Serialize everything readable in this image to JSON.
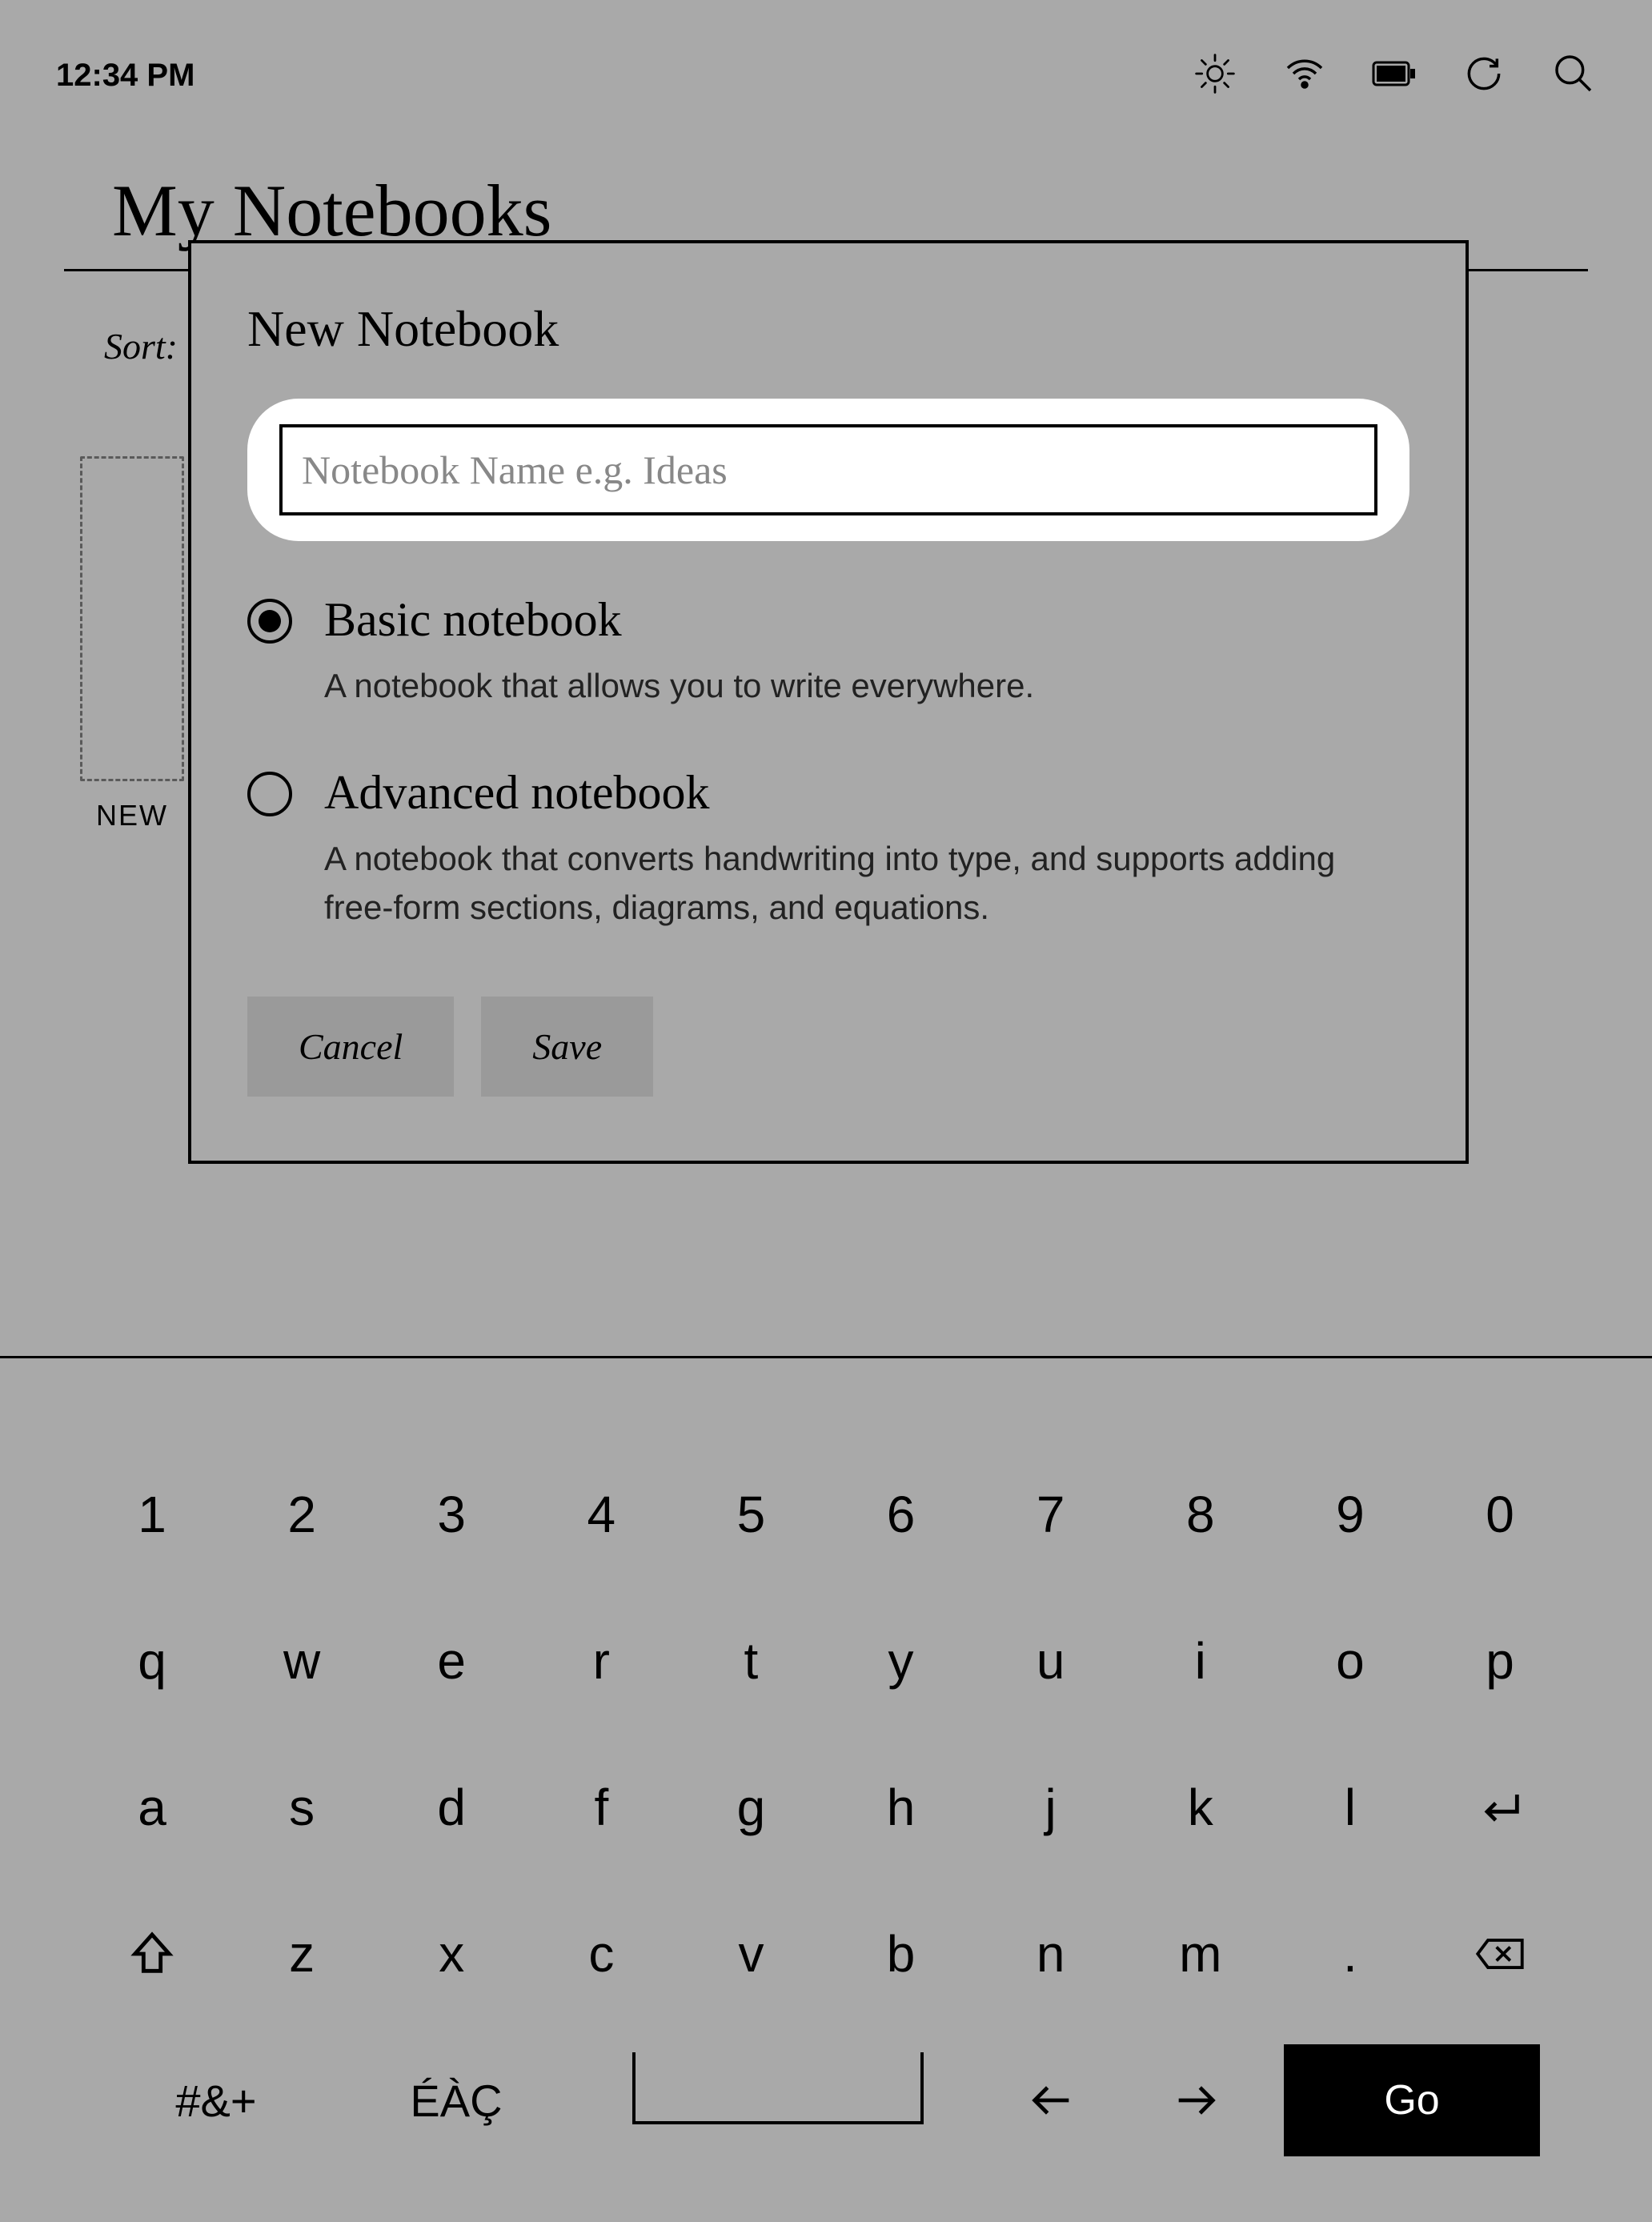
{
  "statusbar": {
    "time": "12:34 PM"
  },
  "page": {
    "title": "My Notebooks",
    "sort_label": "Sort:",
    "new_tile_label": "NEW"
  },
  "modal": {
    "title": "New Notebook",
    "name_placeholder": "Notebook Name e.g. Ideas",
    "name_value": "",
    "options": [
      {
        "title": "Basic notebook",
        "desc": "A notebook that allows you to write everywhere.",
        "selected": true
      },
      {
        "title": "Advanced notebook",
        "desc": "A notebook that converts handwriting into type, and supports adding free-form sections, diagrams, and equations.",
        "selected": false
      }
    ],
    "cancel": "Cancel",
    "save": "Save"
  },
  "keyboard": {
    "row1": [
      "1",
      "2",
      "3",
      "4",
      "5",
      "6",
      "7",
      "8",
      "9",
      "0"
    ],
    "row2": [
      "q",
      "w",
      "e",
      "r",
      "t",
      "y",
      "u",
      "i",
      "o",
      "p"
    ],
    "row3": [
      "a",
      "s",
      "d",
      "f",
      "g",
      "h",
      "j",
      "k",
      "l"
    ],
    "row4_letters": [
      "z",
      "x",
      "c",
      "v",
      "b",
      "n",
      "m",
      "."
    ],
    "sym_key": "#&+",
    "accent_key": "ÉÀÇ",
    "go_key": "Go"
  }
}
